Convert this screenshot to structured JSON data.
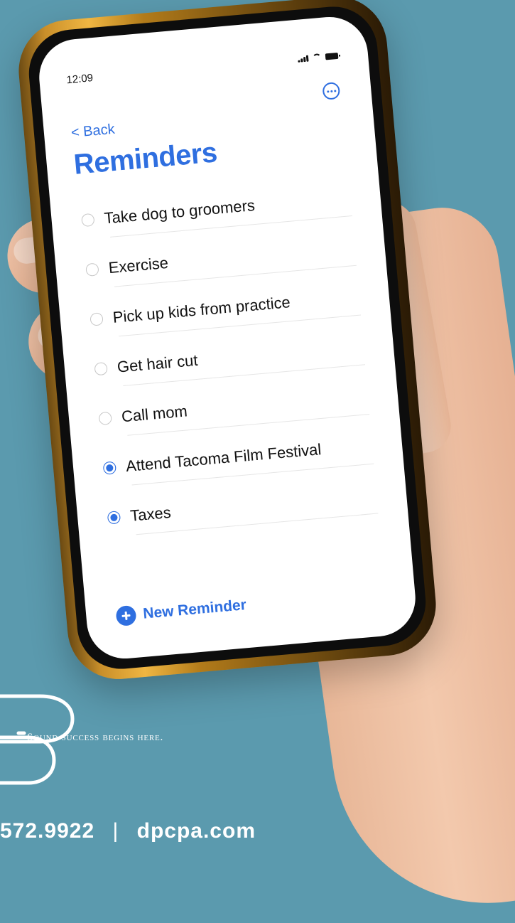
{
  "status_bar": {
    "time": "12:09"
  },
  "nav": {
    "back_label": "< Back"
  },
  "screen": {
    "title": "Reminders",
    "new_reminder_label": "New Reminder"
  },
  "reminders": [
    {
      "label": "Take dog to groomers",
      "checked": false
    },
    {
      "label": "Exercise",
      "checked": false
    },
    {
      "label": "Pick up kids from practice",
      "checked": false
    },
    {
      "label": "Get hair cut",
      "checked": false
    },
    {
      "label": "Call mom",
      "checked": false
    },
    {
      "label": "Attend Tacoma Film Festival",
      "checked": true
    },
    {
      "label": "Taxes",
      "checked": true
    }
  ],
  "brand": {
    "tagline": "Sound success begins here.",
    "phone": "572.9922",
    "website": "dpcpa.com"
  },
  "colors": {
    "background": "#5b9aae",
    "accent": "#2f6fe0",
    "phone_frame": "#f0b642"
  }
}
